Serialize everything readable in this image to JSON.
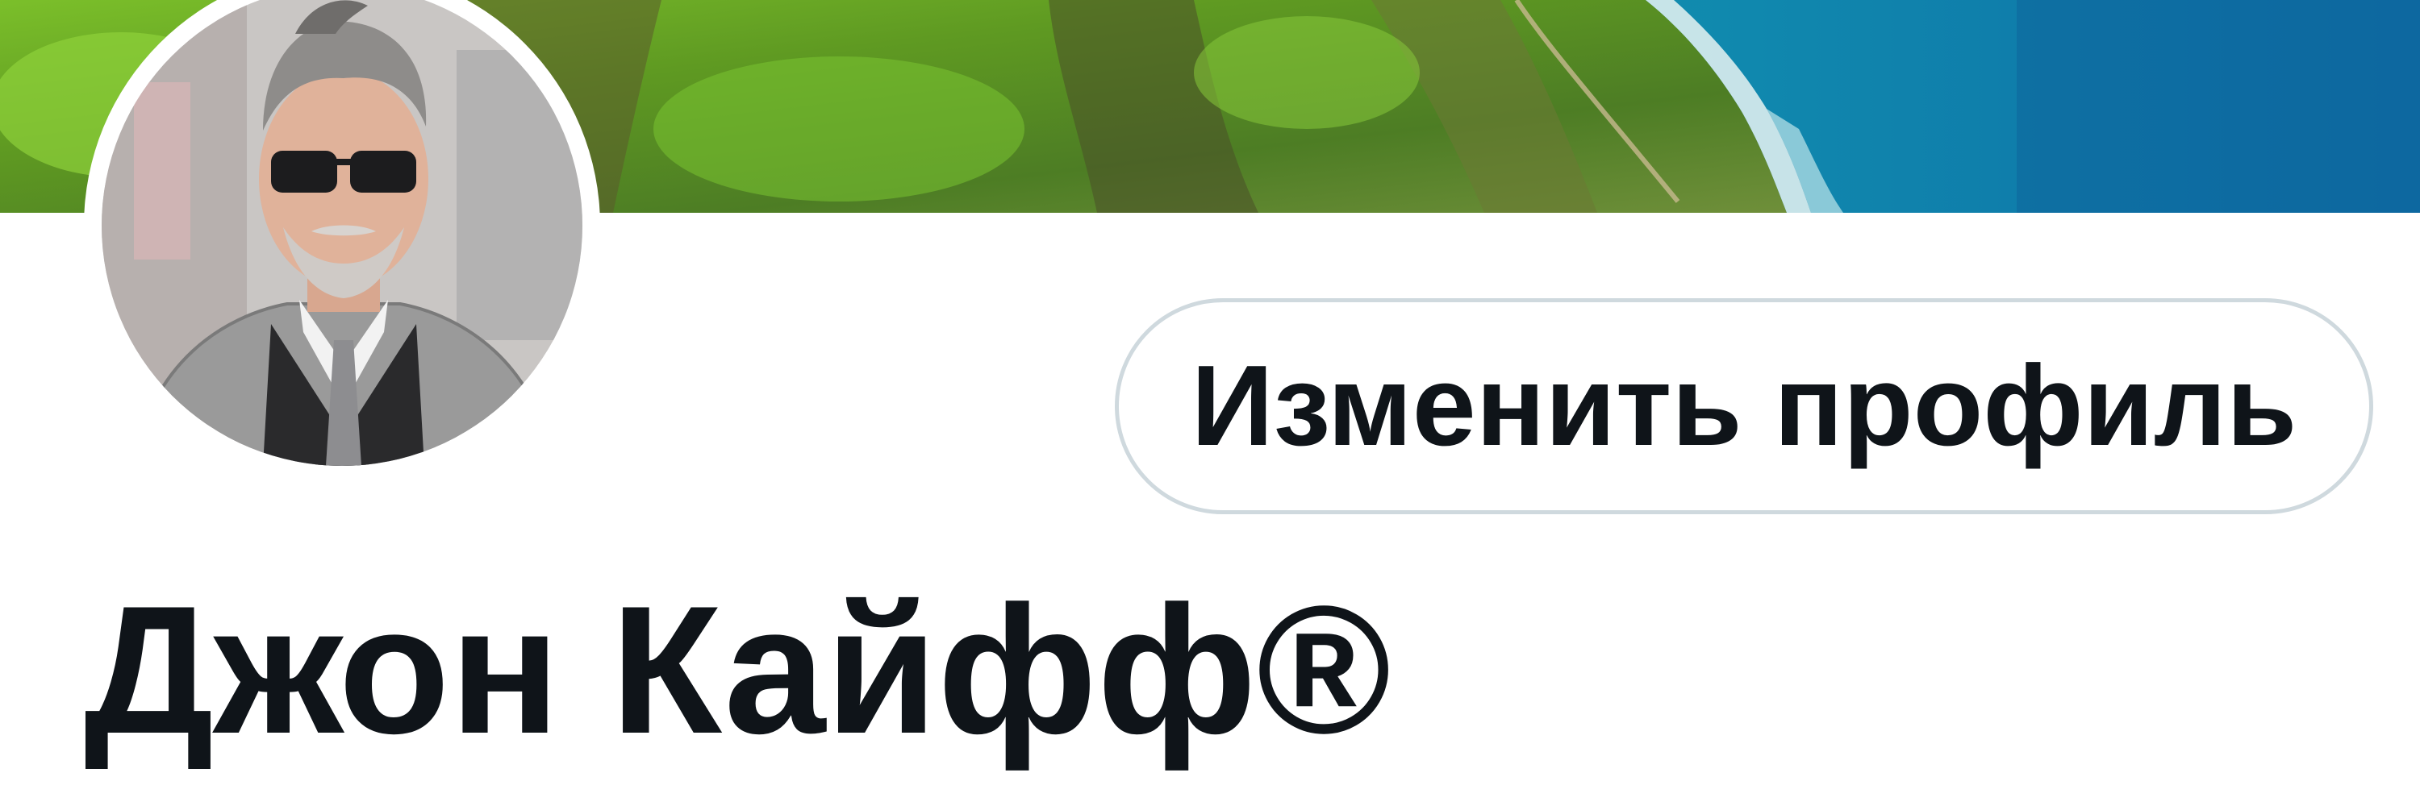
{
  "profile": {
    "display_name": "Джон Кайфф®",
    "edit_button_label": "Изменить профиль",
    "banner_image": "coastal-cliffs-ocean-photo",
    "avatar_image": "man-sunglasses-suit-photo"
  },
  "colors": {
    "text": "#0f1419",
    "button_border": "#cfd9de",
    "background": "#ffffff"
  }
}
